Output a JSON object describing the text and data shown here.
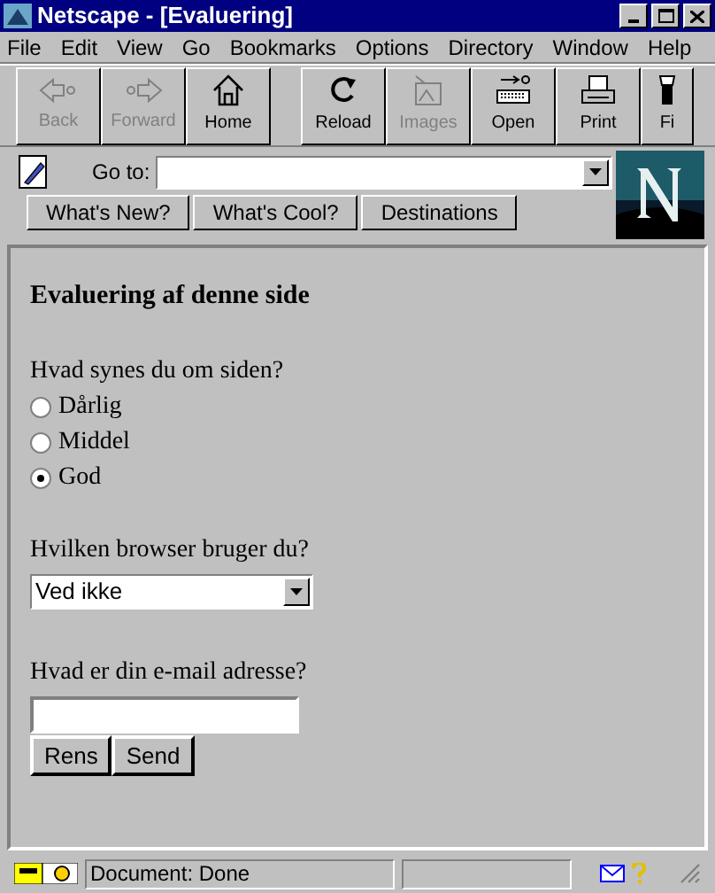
{
  "window": {
    "title": "Netscape - [Evaluering]"
  },
  "menu": [
    "File",
    "Edit",
    "View",
    "Go",
    "Bookmarks",
    "Options",
    "Directory",
    "Window",
    "Help"
  ],
  "toolbar": [
    {
      "label": "Back",
      "kind": "back",
      "disabled": true
    },
    {
      "label": "Forward",
      "kind": "forward",
      "disabled": true
    },
    {
      "label": "Home",
      "kind": "home",
      "disabled": false
    },
    {
      "label": "Reload",
      "kind": "reload",
      "disabled": false
    },
    {
      "label": "Images",
      "kind": "images",
      "disabled": true
    },
    {
      "label": "Open",
      "kind": "open",
      "disabled": false
    },
    {
      "label": "Print",
      "kind": "print",
      "disabled": false
    },
    {
      "label": "Fi",
      "kind": "find",
      "disabled": false
    }
  ],
  "location": {
    "label": "Go to:"
  },
  "directory_buttons": [
    "What's New?",
    "What's Cool?",
    "Destinations"
  ],
  "page": {
    "heading": "Evaluering af denne side",
    "question_1": "Hvad synes du om siden?",
    "options": [
      {
        "label": "Dårlig",
        "selected": false
      },
      {
        "label": "Middel",
        "selected": false
      },
      {
        "label": "God",
        "selected": true
      }
    ],
    "question_2": "Hvilken browser bruger du?",
    "browser_select": "Ved ikke",
    "question_3": "Hvad er din e-mail adresse?",
    "buttons": [
      "Rens",
      "Send"
    ]
  },
  "status_bar": {
    "text": "Document: Done"
  }
}
